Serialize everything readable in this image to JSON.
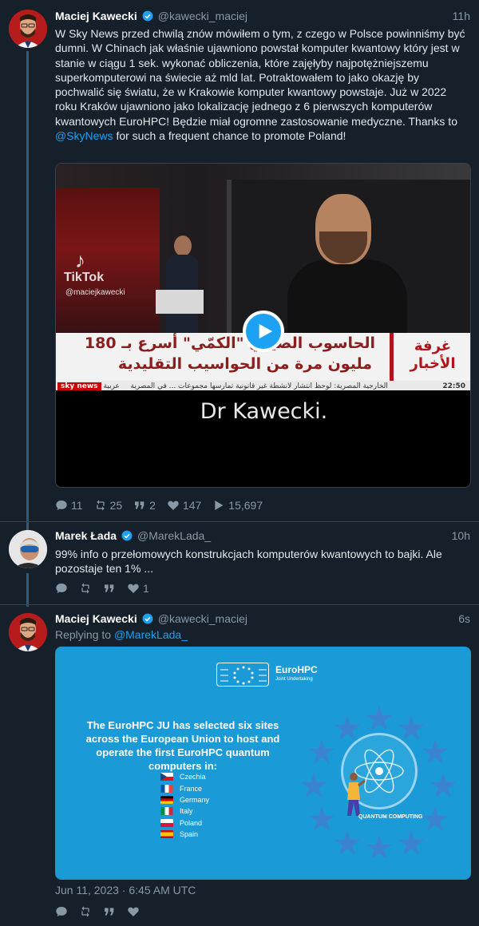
{
  "tweets": [
    {
      "author": "Maciej Kawecki",
      "handle": "@kawecki_maciej",
      "time": "11h",
      "text_before": "W Sky News przed chwilą znów mówiłem o tym, z czego w Polsce powinniśmy być dumni. W Chinach jak właśnie ujawniono powstał komputer kwantowy który jest w stanie w ciągu 1 sek. wykonać obliczenia, które zajęłyby najpotężniejszemu superkomputerowi na świecie aż mld lat. Potraktowałem to jako okazję by pochwalić się światu, że w Krakowie komputer kwantowy powstaje. Już w 2022 roku Kraków ujawniono jako lokalizację jednego z 6 pierwszych komputerów kwantowych EuroHPC! Będzie miał ogromne zastosowanie medyczne. Thanks to ",
      "text_link": "@SkyNews",
      "text_after": " for such a frequent chance to promote Poland!",
      "video": {
        "tiktok_logo": "♪",
        "tiktok_label": "TikTok",
        "tiktok_user": "@maciejkawecki",
        "ticker_line1": "الحاسوب الصيني \"الكمّي\" أسرع بـ 180",
        "ticker_line2": "مليون مرة من الحواسيب التقليدية",
        "ticker_brand_line1": "غرفة",
        "ticker_brand_line2": "الأخبار",
        "ticker_sky": "sky news",
        "ticker_arabia": "عربية",
        "ticker_news": "الخارجية المصرية: لوحظ انتشار لأنشطة غير قانونية تمارسها مجموعات ... في المصرية",
        "ticker_clock": "22:50",
        "caption": "Dr Kawecki."
      },
      "stats": {
        "replies": "11",
        "retweets": "25",
        "quotes": "2",
        "likes": "147",
        "views": "15,697"
      }
    },
    {
      "author": "Marek Łada",
      "handle": "@MarekLada_",
      "time": "10h",
      "text": "99% info o przełomowych konstrukcjach komputerów kwantowych to bajki. Ale pozostaje ten 1% ...",
      "stats": {
        "replies": "",
        "retweets": "",
        "quotes": "",
        "likes": "1"
      }
    },
    {
      "author": "Maciej Kawecki",
      "handle": "@kawecki_maciej",
      "time": "6s",
      "replying_prefix": "Replying to ",
      "replying_to": "@MarekLada_",
      "image": {
        "logo_name": "EuroHPC",
        "logo_sub": "Joint Undertaking",
        "title": "The EuroHPC JU has selected six sites across the European Union to host and operate the first EuroHPC quantum computers in:",
        "countries": [
          "Czechia",
          "France",
          "Germany",
          "Italy",
          "Poland",
          "Spain"
        ],
        "badge": "QUANTUM COMPUTING"
      },
      "date": "Jun 11, 2023 · 6:45 AM UTC"
    }
  ],
  "colors": {
    "background": "#15202b",
    "link": "#1da1f2",
    "muted": "#8899a6",
    "thread_line": "#2b5a85",
    "eurohpc_blue": "#1a9ad6"
  }
}
